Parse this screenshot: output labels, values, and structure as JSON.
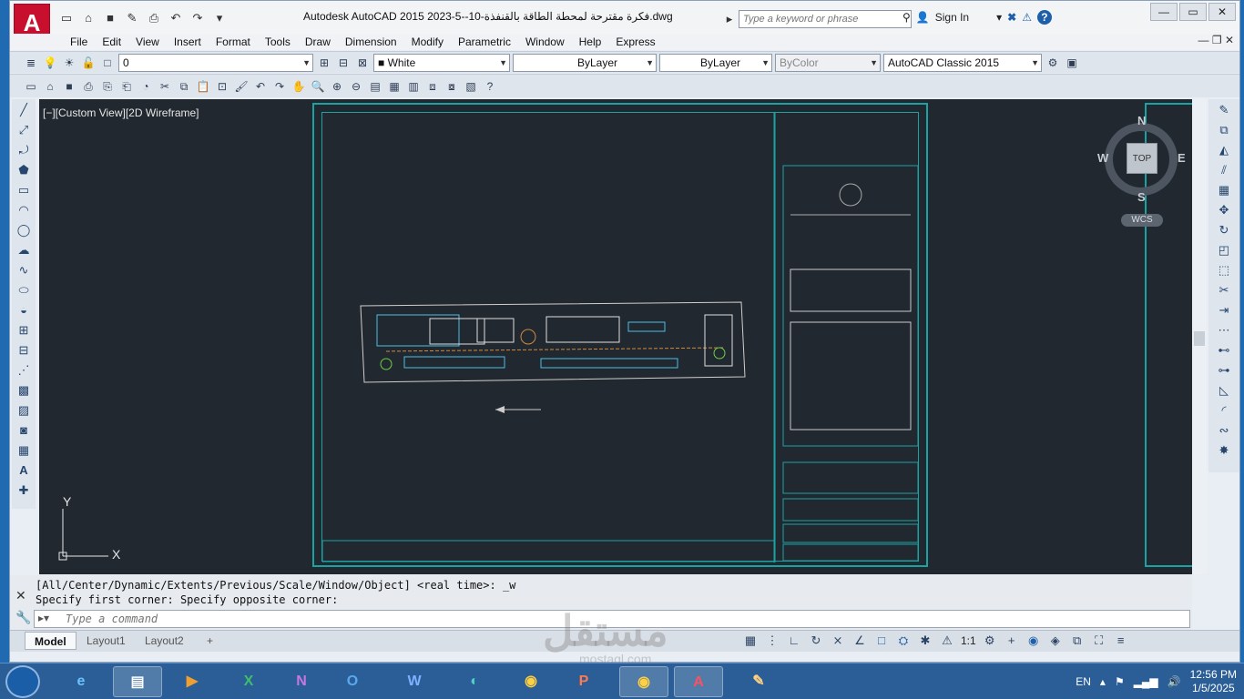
{
  "titlebar": {
    "logo": "A",
    "title": "Autodesk AutoCAD 2015     2023-5--10-فكرة مقترحة لمحطة الطاقة بالقنفذة.dwg",
    "search_placeholder": "Type a keyword or phrase",
    "signin": "Sign In"
  },
  "menu": [
    "File",
    "Edit",
    "View",
    "Insert",
    "Format",
    "Tools",
    "Draw",
    "Dimension",
    "Modify",
    "Parametric",
    "Window",
    "Help",
    "Express"
  ],
  "toolbar": {
    "layer": "0",
    "color": "White",
    "linetype": "ByLayer",
    "lineweight": "ByLayer",
    "plotstyle": "ByColor",
    "workspace": "AutoCAD Classic 2015"
  },
  "viewport": {
    "label": "[−][Custom View][2D Wireframe]",
    "compass": {
      "n": "N",
      "s": "S",
      "e": "E",
      "w": "W",
      "top": "TOP"
    },
    "wcs": "WCS",
    "ucs_x": "X",
    "ucs_y": "Y"
  },
  "command": {
    "history": [
      "[All/Center/Dynamic/Extents/Previous/Scale/Window/Object] <real time>: _w",
      "Specify first corner: Specify opposite corner:"
    ],
    "placeholder": "Type a command"
  },
  "layouts": [
    "Model",
    "Layout1",
    "Layout2",
    "+"
  ],
  "status": {
    "scale": "1:1"
  },
  "watermark": {
    "main": "مستقل",
    "sub": "mostaql.com"
  },
  "taskbar": {
    "apps": [
      "IE",
      "Explorer",
      "Media",
      "Excel",
      "OneNote",
      "Outlook",
      "Word",
      "Edge",
      "Chrome",
      "PowerPoint",
      "Chrome Profile",
      "AutoCAD",
      "Paint"
    ],
    "lang": "EN",
    "time": "12:56 PM",
    "date": "1/5/2025"
  },
  "colors": {
    "accent": "#1aa3a3",
    "canvas": "#212830",
    "autocad_red": "#c8102e"
  }
}
